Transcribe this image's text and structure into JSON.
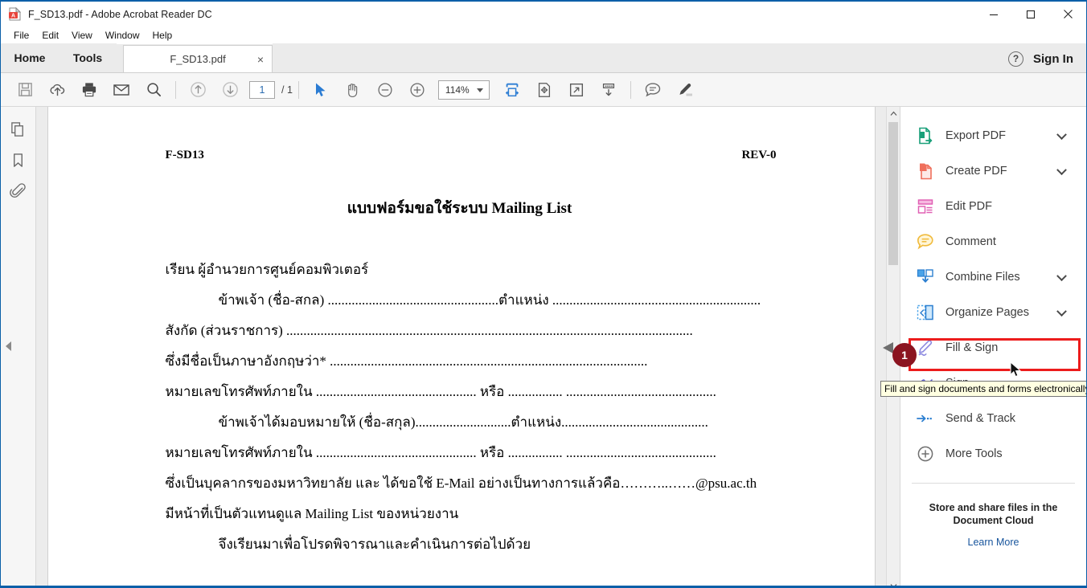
{
  "window": {
    "title": "F_SD13.pdf - Adobe Acrobat Reader DC",
    "app_icon": "pdf-file-icon",
    "minimize": "minimize-icon",
    "maximize": "maximize-icon",
    "close": "close-icon"
  },
  "menubar": {
    "items": [
      {
        "label": "File"
      },
      {
        "label": "Edit"
      },
      {
        "label": "View"
      },
      {
        "label": "Window"
      },
      {
        "label": "Help"
      }
    ]
  },
  "tabstrip": {
    "home": "Home",
    "tools": "Tools",
    "document_tab": "F_SD13.pdf",
    "document_tab_close": "×",
    "help_glyph": "?",
    "sign_in": "Sign In"
  },
  "toolbar": {
    "save": "save-icon",
    "upload_cloud": "upload-to-cloud-icon",
    "print": "print-icon",
    "email": "email-icon",
    "search": "search-icon",
    "prev_page": "previous-page-icon",
    "next_page": "next-page-icon",
    "page_current": "1",
    "page_total": "/ 1",
    "select_tool": "select-cursor-icon",
    "hand_tool": "hand-tool-icon",
    "zoom_out": "zoom-out-icon",
    "zoom_in": "zoom-in-icon",
    "zoom_value": "114%",
    "fit_width": "fit-width-icon",
    "fit_page": "fit-page-icon",
    "full_screen": "full-screen-icon",
    "scroll_mode": "scroll-mode-icon",
    "comment": "comment-bubble-icon",
    "highlight": "highlighter-pen-icon"
  },
  "left_sidebar": {
    "items": [
      {
        "name": "page-thumbnails-icon"
      },
      {
        "name": "bookmarks-icon"
      },
      {
        "name": "attachments-icon"
      }
    ],
    "collapse": "collapse-panel-arrow-icon"
  },
  "document": {
    "form_code": "F-SD13",
    "revision": "REV-0",
    "title": "แบบฟอร์มขอใช้ระบบ Mailing List",
    "salutation": "เรียน ผู้อำนวยการศูนย์คอมพิวเตอร์",
    "lines": [
      {
        "indent": true,
        "text": "ข้าพเจ้า (ชื่อ-สกล) ..................................................ตำแหน่ง ............................................................."
      },
      {
        "indent": false,
        "text": "สังกัด (ส่วนราชการ) ......................................................................................................................."
      },
      {
        "indent": false,
        "text": "ซึ่งมีชื่อเป็นภาษาอังกฤษว่า* ............................................................................................."
      },
      {
        "indent": false,
        "text": "หมายเลขโทรศัพท์ภายใน ............................................... หรือ ................ ............................................"
      },
      {
        "indent": true,
        "text": "ข้าพเจ้าได้มอบหมายให้ (ชื่อ-สกุล)............................ตำแหน่ง..........................................."
      },
      {
        "indent": false,
        "text": "หมายเลขโทรศัพท์ภายใน ............................................... หรือ ................ ............................................"
      },
      {
        "indent": false,
        "text": "ซึ่งเป็นบุคลากรของมหาวิทยาลัย และ ได้ขอใช้ E-Mail อย่างเป็นทางการแล้วคือ………..……@psu.ac.th"
      },
      {
        "indent": false,
        "text": "มีหน้าที่เป็นตัวแทนดูแล Mailing List ของหน่วยงาน"
      },
      {
        "indent": true,
        "text": "จึงเรียนมาเพื่อโปรดพิจารณาและคำเนินการต่อไปด้วย"
      }
    ]
  },
  "right_panel": {
    "tools": [
      {
        "label": "Export PDF",
        "icon": "export-pdf-icon",
        "chevron": true
      },
      {
        "label": "Create PDF",
        "icon": "create-pdf-icon",
        "chevron": true
      },
      {
        "label": "Edit PDF",
        "icon": "edit-pdf-icon",
        "chevron": false
      },
      {
        "label": "Comment",
        "icon": "comment-icon",
        "chevron": false
      },
      {
        "label": "Combine Files",
        "icon": "combine-files-icon",
        "chevron": true
      },
      {
        "label": "Organize Pages",
        "icon": "organize-pages-icon",
        "chevron": true
      },
      {
        "label": "Fill & Sign",
        "icon": "fill-and-sign-icon",
        "chevron": false
      },
      {
        "label": "Sign",
        "icon": "sign-icon",
        "chevron": false
      },
      {
        "label": "Send & Track",
        "icon": "send-and-track-icon",
        "chevron": false
      },
      {
        "label": "More Tools",
        "icon": "more-tools-icon",
        "chevron": false
      }
    ],
    "cloud_note_line1": "Store and share files in the",
    "cloud_note_line2": "Document Cloud",
    "learn_more": "Learn More"
  },
  "annotation": {
    "badge_number": "1",
    "highlight_target": "Fill & Sign",
    "highlight_color": "#ec1c1c",
    "badge_color": "#8b1420",
    "tooltip_text": "Fill and sign documents and forms electronically"
  }
}
